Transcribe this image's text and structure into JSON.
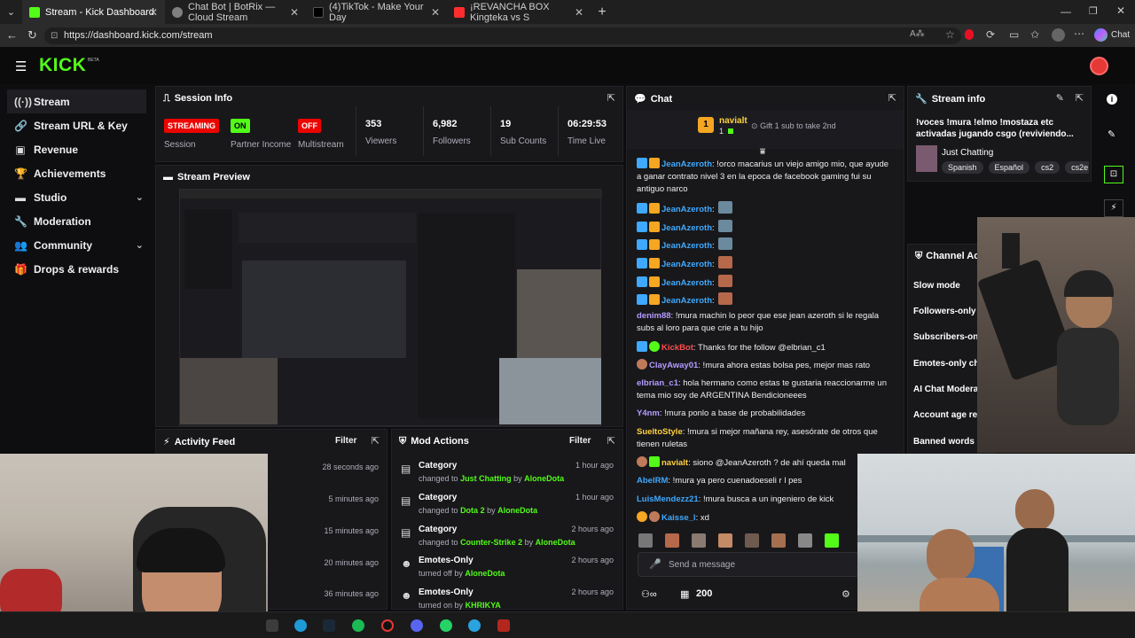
{
  "browser": {
    "tabs": [
      {
        "label": "Stream - Kick Dashboard",
        "color": "#53fc18"
      },
      {
        "label": "Chat Bot | BotRix — Cloud Stream",
        "color": "#7f7f7f"
      },
      {
        "label": "(4)TikTok - Make Your Day",
        "color": "#000000"
      },
      {
        "label": "¡REVANCHA BOX Kingteka vs S",
        "color": "#ff2d2d"
      }
    ],
    "url": "https://dashboard.kick.com/stream",
    "profile_label": "Chat"
  },
  "kick": {
    "logo": "KICK",
    "beta": "BETA"
  },
  "sidebar": {
    "items": [
      {
        "label": "Stream",
        "icon": "signal-icon"
      },
      {
        "label": "Stream URL & Key",
        "icon": "link-icon"
      },
      {
        "label": "Revenue",
        "icon": "money-icon"
      },
      {
        "label": "Achievements",
        "icon": "trophy-icon"
      },
      {
        "label": "Studio",
        "icon": "studio-icon"
      },
      {
        "label": "Moderation",
        "icon": "wrench-icon"
      },
      {
        "label": "Community",
        "icon": "people-icon"
      },
      {
        "label": "Drops & rewards",
        "icon": "gift-icon"
      }
    ]
  },
  "session": {
    "title": "Session Info",
    "stats": [
      {
        "value": "STREAMING",
        "label": "Session",
        "badge": true,
        "color": "#eb0400"
      },
      {
        "value": "ON",
        "label": "Partner Income",
        "badge": true,
        "color": "#53fc18"
      },
      {
        "value": "OFF",
        "label": "Multistream",
        "badge": true,
        "color": "#eb0400"
      },
      {
        "value": "353",
        "label": "Viewers"
      },
      {
        "value": "6,982",
        "label": "Followers"
      },
      {
        "value": "19",
        "label": "Sub Counts"
      },
      {
        "value": "06:29:53",
        "label": "Time Live"
      }
    ]
  },
  "preview": {
    "title": "Stream Preview"
  },
  "activity": {
    "title": "Activity Feed",
    "filter": "Filter",
    "times": [
      "28 seconds ago",
      "5 minutes ago",
      "15 minutes ago",
      "20 minutes ago",
      "36 minutes ago"
    ]
  },
  "mod": {
    "title": "Mod Actions",
    "filter": "Filter",
    "rows": [
      {
        "title": "Category",
        "pre": "changed to",
        "target": "Just Chatting",
        "by": "by",
        "user": "AloneDota",
        "time": "1 hour ago"
      },
      {
        "title": "Category",
        "pre": "changed to",
        "target": "Dota 2",
        "by": "by",
        "user": "AloneDota",
        "time": "1 hour ago"
      },
      {
        "title": "Category",
        "pre": "changed to",
        "target": "Counter-Strike 2",
        "by": "by",
        "user": "AloneDota",
        "time": "2 hours ago"
      },
      {
        "title": "Emotes-Only",
        "pre": "turned off",
        "target": "",
        "by": "by",
        "user": "AloneDota",
        "time": "2 hours ago"
      },
      {
        "title": "Emotes-Only",
        "pre": "turned on",
        "target": "",
        "by": "by",
        "user": "KHRIKYA",
        "time": "2 hours ago"
      }
    ]
  },
  "chat": {
    "title": "Chat",
    "gifter": {
      "rank": "1",
      "name": "navialt",
      "count": "1",
      "cta": "Gift 1 sub to take 2nd"
    },
    "messages": [
      {
        "user": "JeanAzeroth",
        "color": "#3fa9ff",
        "text": ": !orco macarius un viejo amigo mio, que ayude a ganar contrato nivel 3 en la epoca de facebook gaming fui su antiguo narco"
      },
      {
        "user": "JeanAzeroth",
        "color": "#3fa9ff",
        "text": ":"
      },
      {
        "user": "JeanAzeroth",
        "color": "#3fa9ff",
        "text": ":"
      },
      {
        "user": "JeanAzeroth",
        "color": "#3fa9ff",
        "text": ":"
      },
      {
        "user": "JeanAzeroth",
        "color": "#3fa9ff",
        "text": ":"
      },
      {
        "user": "JeanAzeroth",
        "color": "#3fa9ff",
        "text": ":"
      },
      {
        "user": "JeanAzeroth",
        "color": "#3fa9ff",
        "text": ":"
      },
      {
        "user": "denim88",
        "color": "#b59bff",
        "text": ": !mura machin lo peor que ese jean azeroth si le regala subs al loro para que crie a tu hijo"
      },
      {
        "user": "KickBot",
        "color": "#ff4d4d",
        "text": ": Thanks for the follow @elbrian_c1"
      },
      {
        "user": "ClayAway01",
        "color": "#b59bff",
        "text": ": !mura ahora estas bolsa pes, mejor mas rato"
      },
      {
        "user": "elbrian_c1",
        "color": "#b59bff",
        "text": ": hola hermano como estas te gustaria reaccionarme un tema mio soy de ARGENTINA Bendicioneees"
      },
      {
        "user": "Y4nm",
        "color": "#b59bff",
        "text": ": !mura ponlo a base de probabilidades"
      },
      {
        "user": "SueltoStyle",
        "color": "#ffd23f",
        "text": ": !mura si mejor mañana rey, asesórate de otros que tienen ruletas"
      },
      {
        "user": "navialt",
        "color": "#ffd23f",
        "text": ": siono @JeanAzeroth ? de ahí queda mal"
      },
      {
        "user": "AbelRM",
        "color": "#3fa9ff",
        "text": ": !mura ya pero cuenadoeseli r l pes"
      },
      {
        "user": "LuisMendezz21",
        "color": "#3fa9ff",
        "text": ": !mura busca a un ingeniero de kick"
      },
      {
        "user": "Kaisse_l",
        "color": "#3fa9ff",
        "text": ": xd"
      }
    ],
    "placeholder": "Send a message",
    "points": "200"
  },
  "streaminfo": {
    "title": "Stream info",
    "stream_title": "!voces !mura !elmo !mostaza etc activadas jugando csgo (reviviendo...",
    "category": "Just Chatting",
    "tags": [
      "Spanish",
      "Español",
      "cs2",
      "cs2e"
    ]
  },
  "channel": {
    "title": "Channel Acti",
    "settings": [
      "Slow mode",
      "Followers-only c",
      "Subscribers-onl",
      "Emotes-only cha",
      "AI Chat Moderat",
      "Account age res",
      "Banned words"
    ]
  },
  "colors": {
    "accent": "#53fc18",
    "panel": "#18181b",
    "bg": "#0e0e10",
    "live": "#eb0400"
  }
}
